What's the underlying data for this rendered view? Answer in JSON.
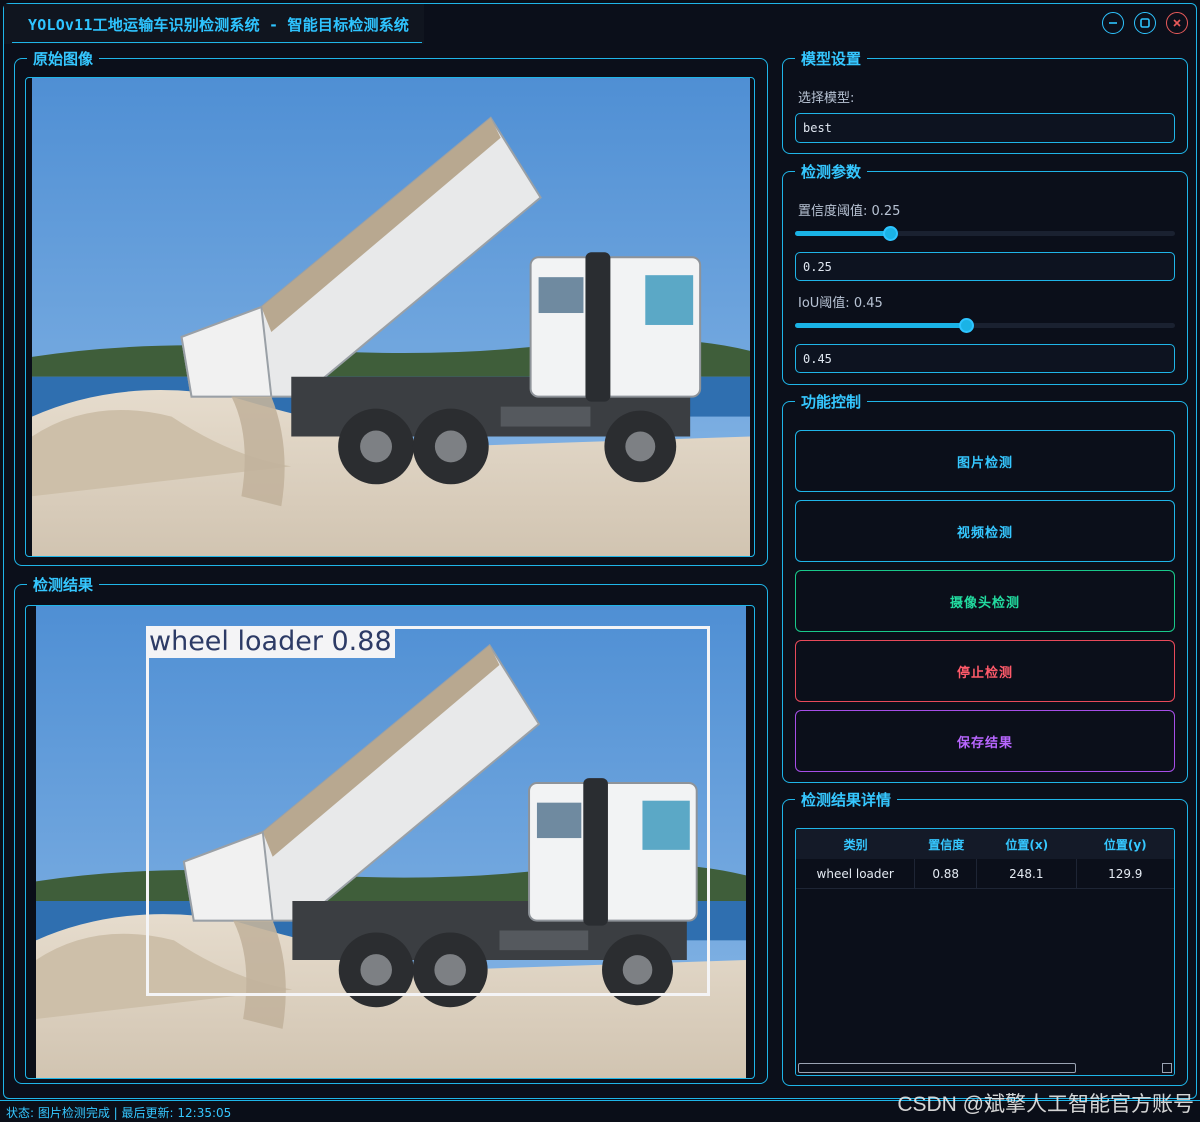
{
  "window": {
    "title": "YOLOv11工地运输车识别检测系统 - 智能目标检测系统",
    "minimize_icon": "minimize-icon",
    "maximize_icon": "maximize-icon",
    "close_icon": "close-icon"
  },
  "original_panel": {
    "title": "原始图像"
  },
  "result_panel": {
    "title": "检测结果",
    "box_label": "wheel loader 0.88"
  },
  "model_settings": {
    "title": "模型设置",
    "select_label": "选择模型:",
    "selected_model": "best"
  },
  "detect_params": {
    "title": "检测参数",
    "confidence_label": "置信度阈值: 0.25",
    "confidence_value": "0.25",
    "confidence_level": 0.25,
    "iou_label": "IoU阈值: 0.45",
    "iou_value": "0.45",
    "iou_level": 0.45
  },
  "controls": {
    "title": "功能控制",
    "image_detect": "图片检测",
    "video_detect": "视频检测",
    "camera_detect": "摄像头检测",
    "stop_detect": "停止检测",
    "save_result": "保存结果"
  },
  "details": {
    "title": "检测结果详情",
    "columns": [
      "类别",
      "置信度",
      "位置(x)",
      "位置(y)"
    ],
    "rows": [
      [
        "wheel loader",
        "0.88",
        "248.1",
        "129.9"
      ]
    ]
  },
  "status": {
    "text": "状态: 图片检测完成 | 最后更新: 12:35:05"
  },
  "watermark": "CSDN @斌擎人工智能官方账号",
  "colors": {
    "accent": "#1fb5e8",
    "button_blue": "#1fb5e8",
    "button_green": "#19c98a",
    "button_red": "#e84a5a",
    "button_purple": "#a64ee8"
  }
}
